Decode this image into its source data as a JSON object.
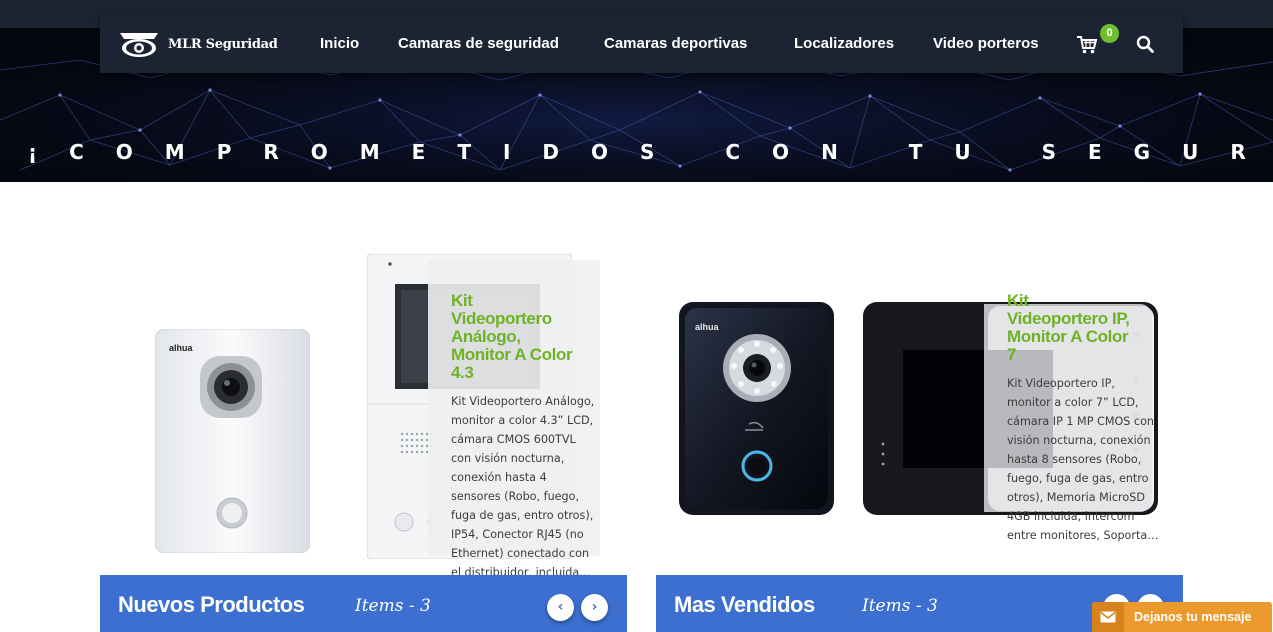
{
  "brand": {
    "name": "MLR Seguridad"
  },
  "nav": {
    "items": [
      {
        "label": "Inicio"
      },
      {
        "label": "Camaras de seguridad"
      },
      {
        "label": "Camaras deportivas"
      },
      {
        "label": "Localizadores"
      },
      {
        "label": "Video porteros"
      }
    ],
    "cart_count": "0",
    "cart_icon": "cart-icon",
    "search_icon": "search-icon"
  },
  "hero": {
    "tagline": "¡COMPROMETIDOS CON TU SEGURIDAD!"
  },
  "products": [
    {
      "title_lines": [
        "Kit",
        "Videoportero",
        "Análogo,",
        "Monitor A Color",
        "4.3"
      ],
      "description": "Kit Videoportero Análogo, monitor a color 4.3” LCD, cámara CMOS 600TVL con visión nocturna, conexión hasta 4 sensores (Robo, fuego, fuga de gas, entro otros), IP54, Conector RJ45 (no Ethernet) conectado con el distribuidor, incluida…",
      "brand_mark": "alhua"
    },
    {
      "title_lines": [
        "Kit",
        "Videoportero IP,",
        "Monitor A Color",
        "7"
      ],
      "description": "Kit Videoportero IP, monitor a color 7” LCD, cámara IP 1 MP CMOS con visión nocturna, conexión hasta 8 sensores (Robo, fuego, fuga de gas, entro otros), Memoria MicroSD 4GB incluida, intercom entre monitores, Soporta…",
      "brand_mark": "alhua"
    }
  ],
  "sections": [
    {
      "title": "Nuevos Productos",
      "count": "Items - 3"
    },
    {
      "title": "Mas Vendidos",
      "count": "Items - 3"
    }
  ],
  "carousel": {
    "prev": "‹",
    "next": "›"
  },
  "chat": {
    "label": "Dejanos tu mensaje",
    "icon": "mail-icon"
  },
  "colors": {
    "nav_bg": "#1c2333",
    "accent_green": "#6fb227",
    "section_blue": "#3c6fd0",
    "chat_orange": "#ec9a2e"
  }
}
